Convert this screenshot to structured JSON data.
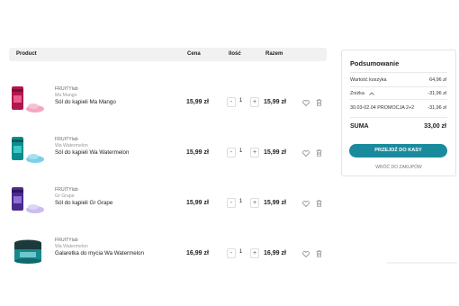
{
  "table": {
    "col_product": "Product",
    "col_price": "Cena",
    "col_qty": "Ilość",
    "col_total": "Razem"
  },
  "items": [
    {
      "brand": "FRUITYlab",
      "variant": "Ma Mango",
      "name": "Sól do kąpieli Ma Mango",
      "price": "15,99 zł",
      "qty": "1",
      "total": "15,99 zł",
      "colors": {
        "jar": "#b0174e",
        "powder": "#f2a7c3"
      }
    },
    {
      "brand": "FRUITYlab",
      "variant": "Wa Watermelon",
      "name": "Sól do kąpieli Wa Watermelon",
      "price": "15,99 zł",
      "qty": "1",
      "total": "15,99 zł",
      "colors": {
        "jar": "#0e8c8c",
        "powder": "#7ccfe8"
      }
    },
    {
      "brand": "FRUITYlab",
      "variant": "Gr Grape",
      "name": "Sól do kąpieli Gr Grape",
      "price": "15,99 zł",
      "qty": "1",
      "total": "15,99 zł",
      "colors": {
        "jar": "#4b2a8c",
        "powder": "#c9bdf0"
      }
    },
    {
      "brand": "FRUITYlab",
      "variant": "Wa Watermelon",
      "name": "Galaretka do mycia Wa Watermelon",
      "price": "16,99 zł",
      "qty": "1",
      "total": "16,99 zł",
      "colors": {
        "jar": "#158a8f",
        "powder": "#6fc7c9"
      }
    }
  ],
  "controls": {
    "minus": "-",
    "plus": "+"
  },
  "summary": {
    "title": "Podsumowanie",
    "cart_value_label": "Wartość koszyka",
    "cart_value": "64,96 zł",
    "discount_label": "Zniżka",
    "discount_value": "-31,96 zł",
    "promo_label": "30.03-02.04 PROMOCJA 2+2",
    "promo_value": "-31,96 zł",
    "sum_label": "SUMA",
    "sum_value": "33,00 zł",
    "checkout_label": "PRZEJDŹ DO KASY",
    "back_label": "WRÓĆ DO ZAKUPÓW"
  },
  "accent_color": "#1a8b9d"
}
